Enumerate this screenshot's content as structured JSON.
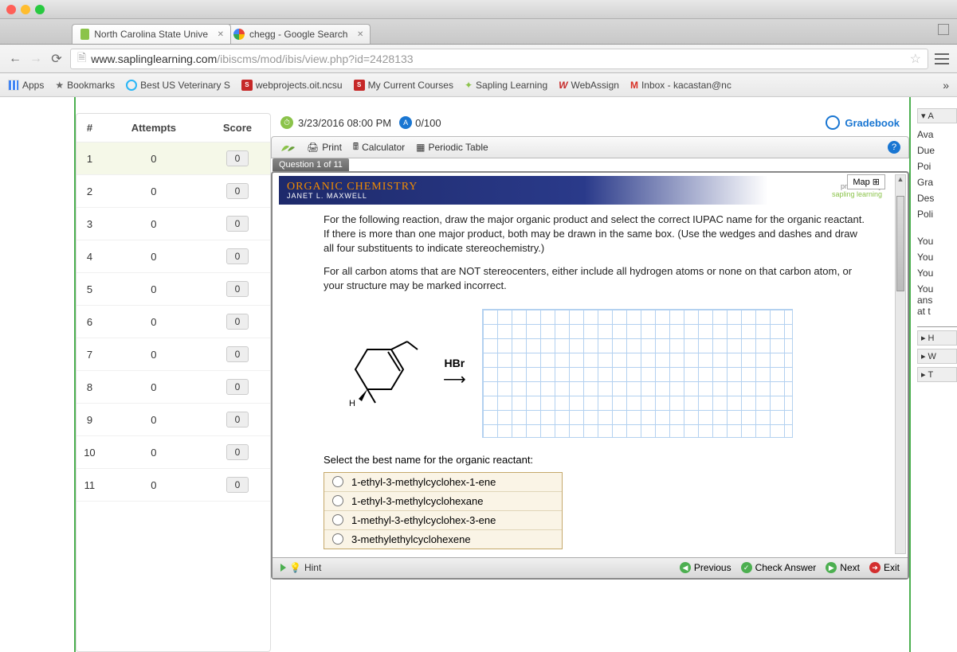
{
  "tabs": [
    {
      "title": "North Carolina State Unive",
      "active": true
    },
    {
      "title": "chegg - Google Search",
      "active": false
    }
  ],
  "url": {
    "domain": "www.saplinglearning.com",
    "path": "/ibiscms/mod/ibis/view.php?id=2428133"
  },
  "bookmarks": {
    "apps": "Apps",
    "items": [
      "Bookmarks",
      "Best US Veterinary S",
      "webprojects.oit.ncsu",
      "My Current Courses",
      "Sapling Learning",
      "WebAssign",
      "Inbox - kacastan@nc"
    ]
  },
  "qtable": {
    "headers": [
      "#",
      "Attempts",
      "Score"
    ],
    "rows": [
      {
        "n": "1",
        "a": "0",
        "s": "0",
        "active": true
      },
      {
        "n": "2",
        "a": "0",
        "s": "0"
      },
      {
        "n": "3",
        "a": "0",
        "s": "0"
      },
      {
        "n": "4",
        "a": "0",
        "s": "0"
      },
      {
        "n": "5",
        "a": "0",
        "s": "0"
      },
      {
        "n": "6",
        "a": "0",
        "s": "0"
      },
      {
        "n": "7",
        "a": "0",
        "s": "0"
      },
      {
        "n": "8",
        "a": "0",
        "s": "0"
      },
      {
        "n": "9",
        "a": "0",
        "s": "0"
      },
      {
        "n": "10",
        "a": "0",
        "s": "0"
      },
      {
        "n": "11",
        "a": "0",
        "s": "0"
      }
    ]
  },
  "assign": {
    "due": "3/23/2016 08:00 PM",
    "score": "0/100",
    "gradebook": "Gradebook",
    "toolbar": {
      "print": "Print",
      "calc": "Calculator",
      "periodic": "Periodic Table"
    },
    "qlabel": "Question 1 of 11",
    "banner": {
      "title": "ORGANIC CHEMISTRY",
      "author": "JANET L. MAXWELL",
      "presented": "presented by",
      "brand": "sapling learning",
      "map": "Map"
    },
    "prompt1": "For the following reaction, draw the major organic product and select the correct IUPAC name for the organic reactant. If there is more than one major product, both may be drawn in the same box. (Use the wedges and dashes and draw all four substituents to indicate stereochemistry.)",
    "prompt2": "For all carbon atoms that are NOT stereocenters, either include all hydrogen atoms or none on that carbon atom, or your structure may be marked incorrect.",
    "reagent": "HBr",
    "select_label": "Select the best name for the organic reactant:",
    "options": [
      "1-ethyl-3-methylcyclohex-1-ene",
      "1-ethyl-3-methylcyclohexane",
      "1-methyl-3-ethylcyclohex-3-ene",
      "3-methylethylcyclohexene"
    ],
    "footer": {
      "hint": "Hint",
      "prev": "Previous",
      "check": "Check Answer",
      "next": "Next",
      "exit": "Exit"
    },
    "mol_h": "H"
  },
  "rightcut": {
    "hdr": "A",
    "items": [
      "Ava",
      "Due",
      "Poi",
      "Gra",
      "Des",
      "Poli"
    ],
    "you": [
      "You",
      "You",
      "You"
    ],
    "you_block": "You\nans\nat t",
    "accordion": [
      "H",
      "W",
      "T"
    ]
  }
}
